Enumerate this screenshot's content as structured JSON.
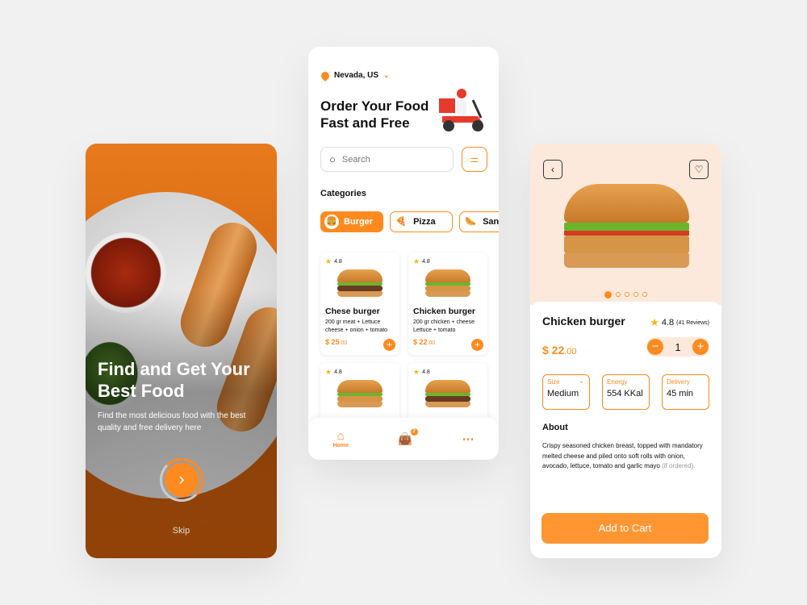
{
  "colors": {
    "accent": "#ff8a1f"
  },
  "onboarding": {
    "title": "Find and Get Your Best Food",
    "subtitle": "Find the most delicious food with the best quality and free delivery here",
    "next_icon": "chevron-right-icon",
    "skip": "Skip"
  },
  "home": {
    "location": "Nevada, US",
    "headline": "Order Your Food Fast and Free",
    "search_placeholder": "Search",
    "categories_title": "Categories",
    "categories": [
      {
        "label": "Burger",
        "icon": "🍔",
        "active": true
      },
      {
        "label": "Pizza",
        "icon": "🍕"
      },
      {
        "label": "Sandwich",
        "icon": "🌭"
      }
    ],
    "items": [
      {
        "rating": "4.8",
        "name": "Chese burger",
        "desc": "200 gr meat + Lettuce cheese + onion + tomato",
        "price": "$ 25",
        "cents": ".00"
      },
      {
        "rating": "4.8",
        "name": "Chicken burger",
        "desc": "200 gr chicken + cheese Lettuce + tomato",
        "price": "$ 22",
        "cents": ".00"
      },
      {
        "rating": "4.8"
      },
      {
        "rating": "4.8"
      }
    ],
    "nav": {
      "home": "Home",
      "cart_badge": "2"
    }
  },
  "detail": {
    "name": "Chicken burger",
    "rating": "4.8",
    "reviews": "(41 Reviews)",
    "price": "$ 22",
    "cents": ".00",
    "quantity": "1",
    "specs": [
      {
        "label": "Size",
        "value": "Medium"
      },
      {
        "label": "Energy",
        "value": "554 KKal"
      },
      {
        "label": "Delivery",
        "value": "45 min"
      }
    ],
    "about_title": "About",
    "about": "Crispy seasoned chicken breast, topped with mandatory melted cheese and piled onto soft rolls with onion, avocado, lettuce, tomato and garlic mayo",
    "about_note": "(if ordered).",
    "image_count": 5,
    "image_index": 1,
    "cta": "Add to Cart"
  }
}
